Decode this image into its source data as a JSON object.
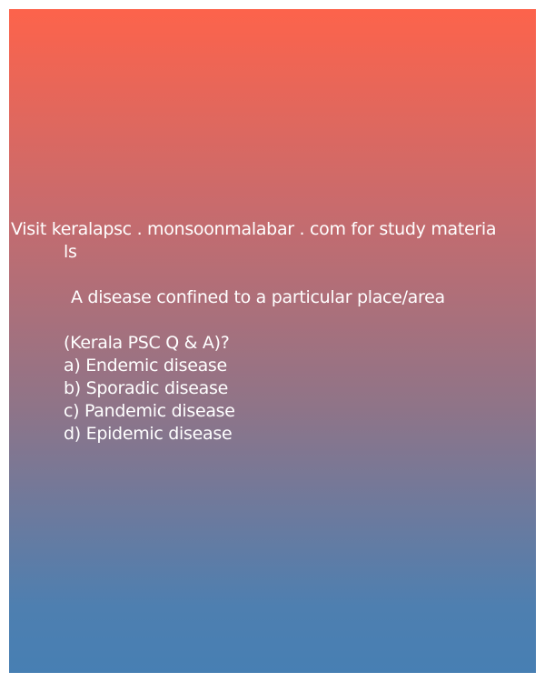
{
  "header": {
    "line1": "Visit keralapsc . monsoonmalabar . com for study materia",
    "line2": "ls"
  },
  "question": {
    "text": "A disease confined to a particular place/area",
    "subtext": "(Kerala PSC Q & A)?"
  },
  "options": [
    "a) Endemic disease",
    "b) Sporadic disease",
    "c) Pandemic disease",
    "d) Epidemic disease"
  ]
}
